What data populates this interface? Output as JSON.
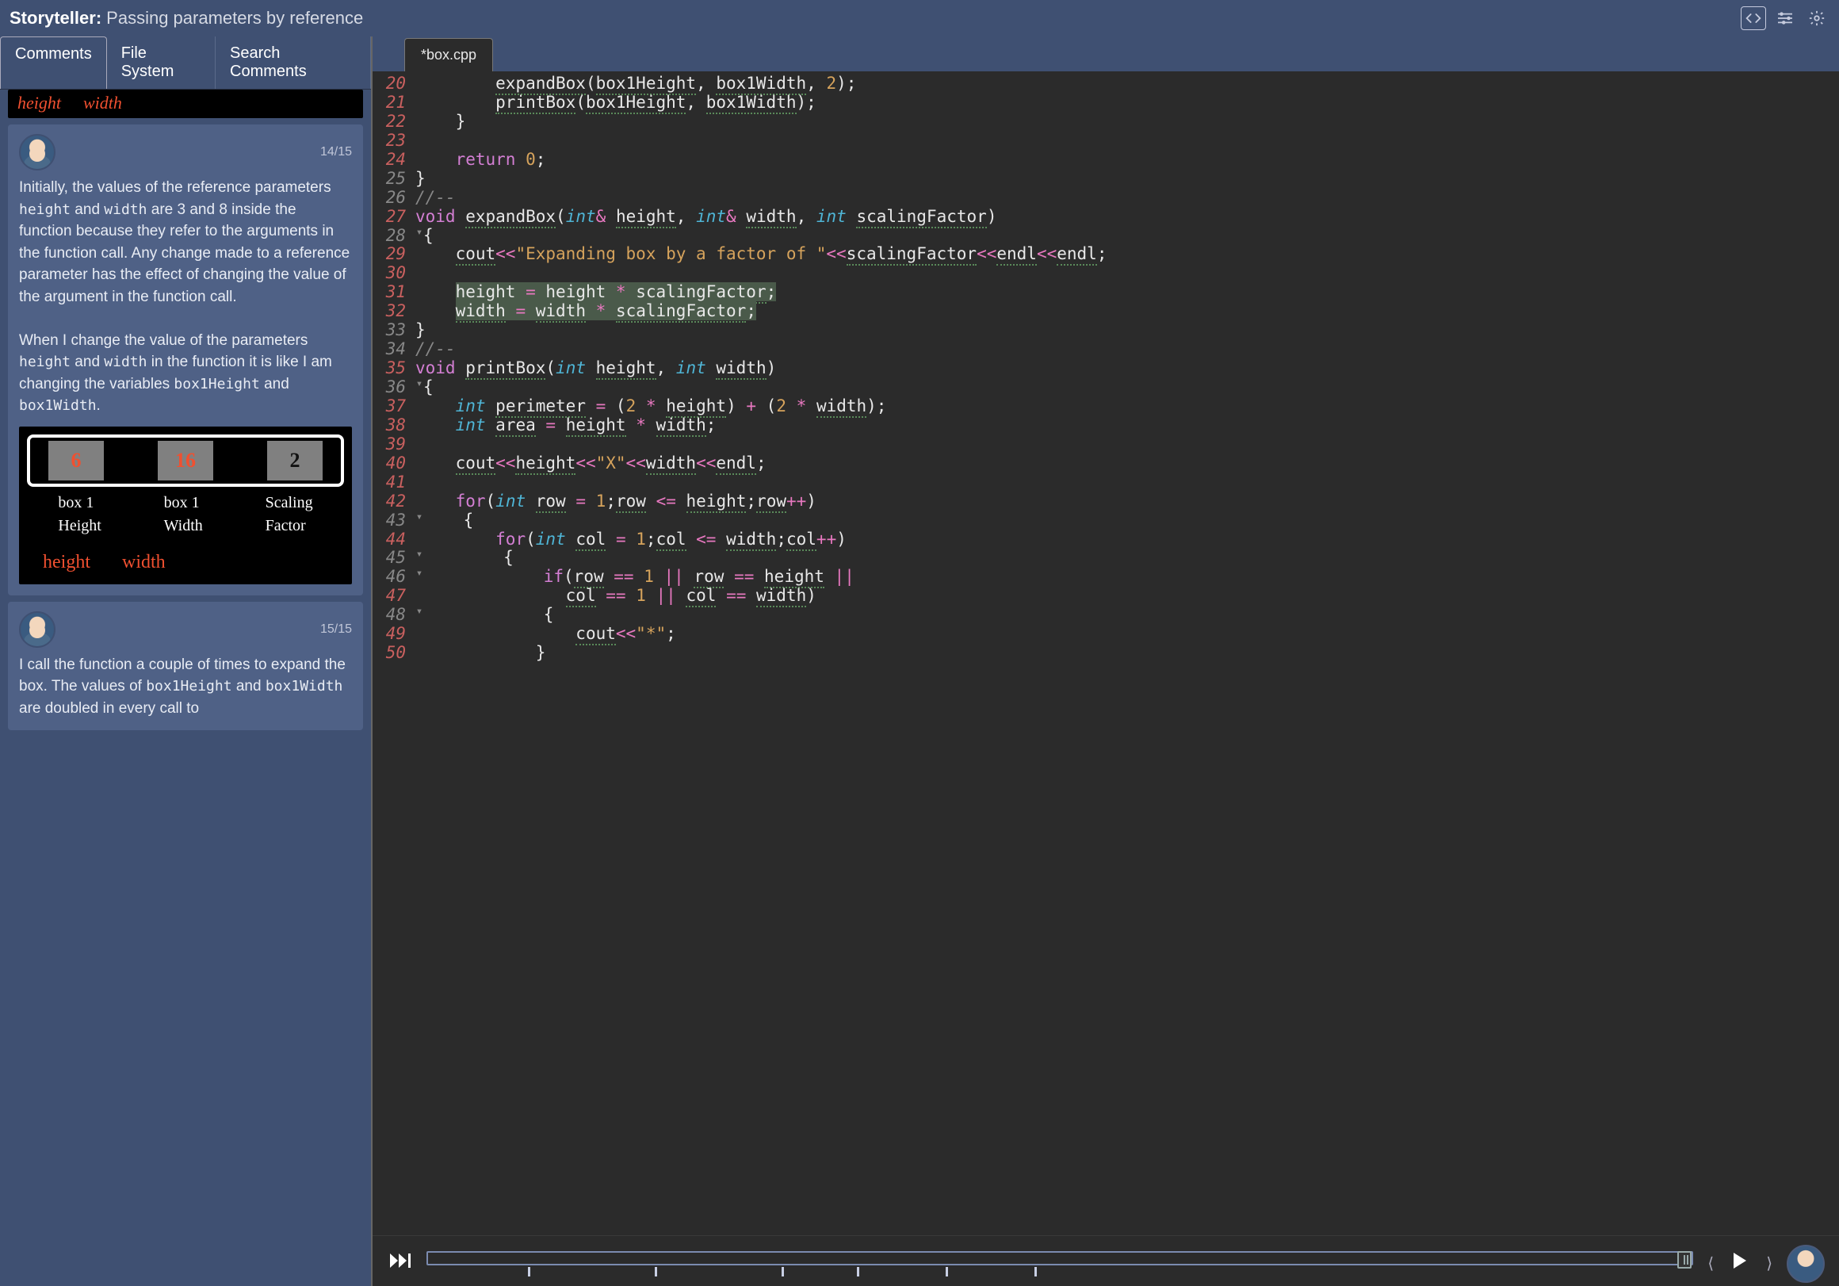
{
  "header": {
    "app": "Storyteller:",
    "title": "Passing parameters by reference"
  },
  "leftTabs": {
    "comments": "Comments",
    "fs": "File System",
    "search": "Search Comments"
  },
  "frag": {
    "height": "height",
    "width": "width"
  },
  "comment1": {
    "count": "14/15",
    "p1a": "Initially, the values of the reference parameters ",
    "p1b": "height",
    "p1c": " and ",
    "p1d": "width",
    "p1e": " are 3 and 8 inside the function because they refer to the arguments in the function call. Any change made to a reference parameter has the effect of changing the value of the argument in the function call.",
    "p2a": "When I change the value of the parameters ",
    "p2b": "height",
    "p2c": " and ",
    "p2d": "width",
    "p2e": " in the function it is like I am changing the variables ",
    "p2f": "box1Height",
    "p2g": " and ",
    "p2h": "box1Width",
    "p2i": "."
  },
  "sketch": {
    "cell1": "6",
    "cell2": "16",
    "cell3": "2",
    "l1": "box 1",
    "l1b": "Height",
    "l2": "box 1",
    "l2b": "Width",
    "l3": "Scaling",
    "l3b": "Factor",
    "r1": "height",
    "r2": "width"
  },
  "comment2": {
    "count": "15/15",
    "p1a": "I call the function a couple of times to expand the box. The values of ",
    "p1b": "box1Height",
    "p1c": " and ",
    "p1d": "box1Width",
    "p1e": " are doubled in every call to "
  },
  "fileTab": "*box.cpp",
  "code": {
    "l20": "            expandBox(box1Height, box1Width, 2);",
    "l21": "            printBox(box1Height, box1Width);",
    "l22": "    }",
    "l23": "",
    "l24k": "return",
    "l24n": "0",
    "l24s": ";",
    "l25": "}",
    "l26": "//--",
    "l27_void": "void",
    "l27_fn": "expandBox",
    "l27_p": "(",
    "l27_int": "int",
    "l27_amp": "& ",
    "l27_h": "height",
    "l27_c": ", ",
    "l27_w": "width",
    "l27_sf": "scalingFactor",
    "l27_cp": ")",
    "l28": "{",
    "l29a": "cout",
    "l29b": "<<",
    "l29c": "\"Expanding box by a factor of \"",
    "l29d": "scalingFactor",
    "l29e": "endl",
    "l31a": "height",
    "l31b": " = ",
    "l31c": "height * scalingFactor;",
    "l32a": "width",
    "l32b": " = ",
    "l32c": "width * scalingFactor;",
    "l33": "}",
    "l34": "//--",
    "l35_void": "void",
    "l35_fn": "printBox",
    "l35_h": "height",
    "l35_w": "width",
    "l36": "{",
    "l37a": "perimeter",
    "l37b": "(2 * height)",
    "l37c": "(2 * width)",
    "l38a": "area",
    "l38b": "height * width",
    "l40a": "cout",
    "l40b": "height",
    "l40c": "\"X\"",
    "l40d": "width",
    "l40e": "endl",
    "l42a": "for",
    "l42b": "row",
    "l42c": "1",
    "l42d": "height",
    "l42e": "row++",
    "l43": "{",
    "l44a": "for",
    "l44b": "col",
    "l44c": "1",
    "l44d": "width",
    "l44e": "col++",
    "l45": "{",
    "l46a": "if",
    "l46b": "row",
    "l46c": "1",
    "l46d": "height",
    "l47a": "col",
    "l47b": "1",
    "l47c": "width",
    "l48": "{",
    "l49a": "cout",
    "l49b": "\"*\"",
    "l50": "}"
  },
  "playback": {
    "progress": 98
  },
  "ticks": [
    8,
    18,
    28,
    34,
    41,
    48
  ]
}
